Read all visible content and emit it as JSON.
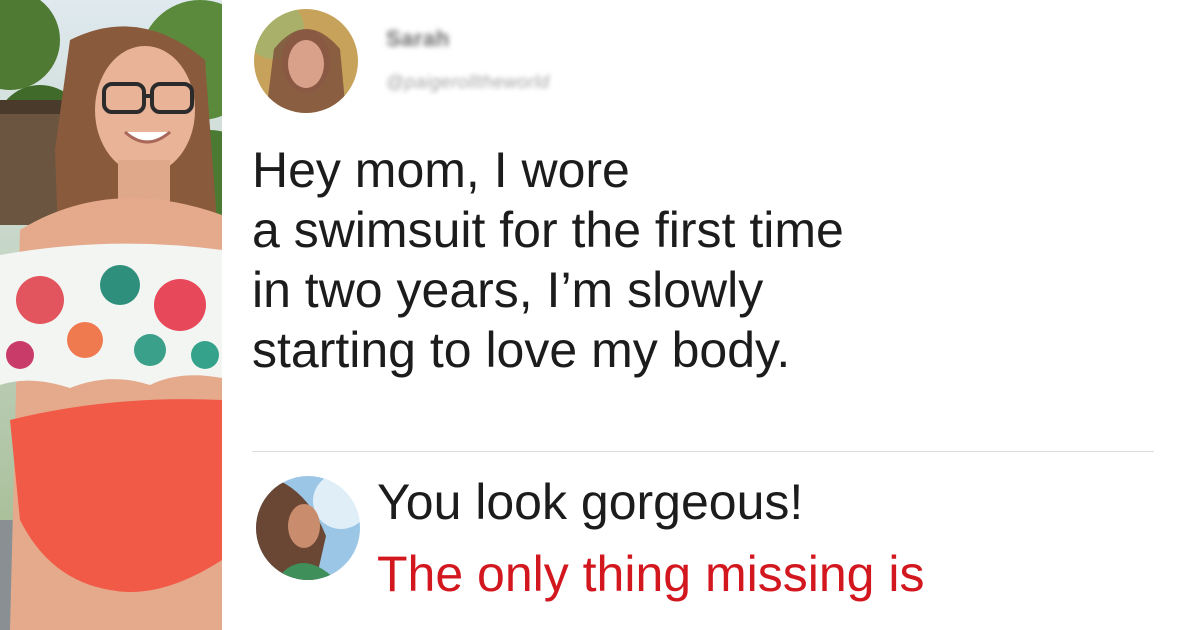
{
  "post": {
    "username": "Sarah",
    "handle": "@paigerolltheworld",
    "text_lines": [
      "Hey mom, I wore",
      "a swimsuit for the first time",
      "in two years, I’m slowly",
      "starting to love my body."
    ]
  },
  "reply": {
    "line_1": "You look gorgeous!",
    "line_2": "The only thing missing is"
  },
  "icons": {
    "post_avatar": "profile-photo",
    "reply_avatar": "profile-photo"
  },
  "colors": {
    "text": "#1c1c1c",
    "accent_red": "#d3171f",
    "divider": "#dcdcdc"
  }
}
